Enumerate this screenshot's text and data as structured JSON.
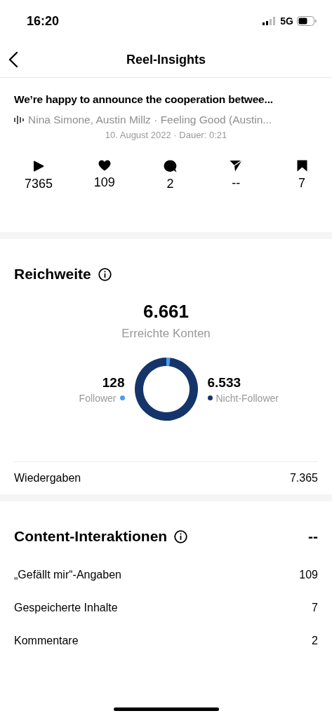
{
  "status_bar": {
    "time": "16:20",
    "network": "5G"
  },
  "nav": {
    "title": "Reel-Insights"
  },
  "post": {
    "caption": "We’re happy to announce the cooperation betwee...",
    "audio": "Nina Simone, Austin Millz · Feeling Good (Austin...",
    "meta": "10. August 2022 · Dauer: 0:21"
  },
  "stats": [
    {
      "kind": "plays",
      "value": "7365"
    },
    {
      "kind": "likes",
      "value": "109"
    },
    {
      "kind": "comments",
      "value": "2"
    },
    {
      "kind": "shares",
      "value": "--"
    },
    {
      "kind": "saves",
      "value": "7"
    }
  ],
  "reach": {
    "title": "Reichweite",
    "total": "6.661",
    "total_label": "Erreichte Konten",
    "legend": [
      {
        "value": "128",
        "color": "#4a9df0"
      },
      {
        "value": "6.533",
        "color": "#15356a"
      }
    ],
    "chart_data": {
      "type": "donut",
      "categories": [
        "Follower",
        "Nicht-Follower"
      ],
      "series": [
        {
          "values": [
            1.92,
            98.08
          ]
        }
      ]
    },
    "rows": [
      {
        "label": "Wiedergaben",
        "value": "7.365"
      }
    ]
  },
  "interactions": {
    "title": "Content-Interaktionen",
    "total": "--",
    "rows": [
      {
        "label": "„Gefällt mir“-Angaben",
        "value": "109"
      },
      {
        "label": "Gespeicherte Inhalte",
        "value": "7"
      },
      {
        "label": "Kommentare",
        "value": "2"
      }
    ]
  }
}
